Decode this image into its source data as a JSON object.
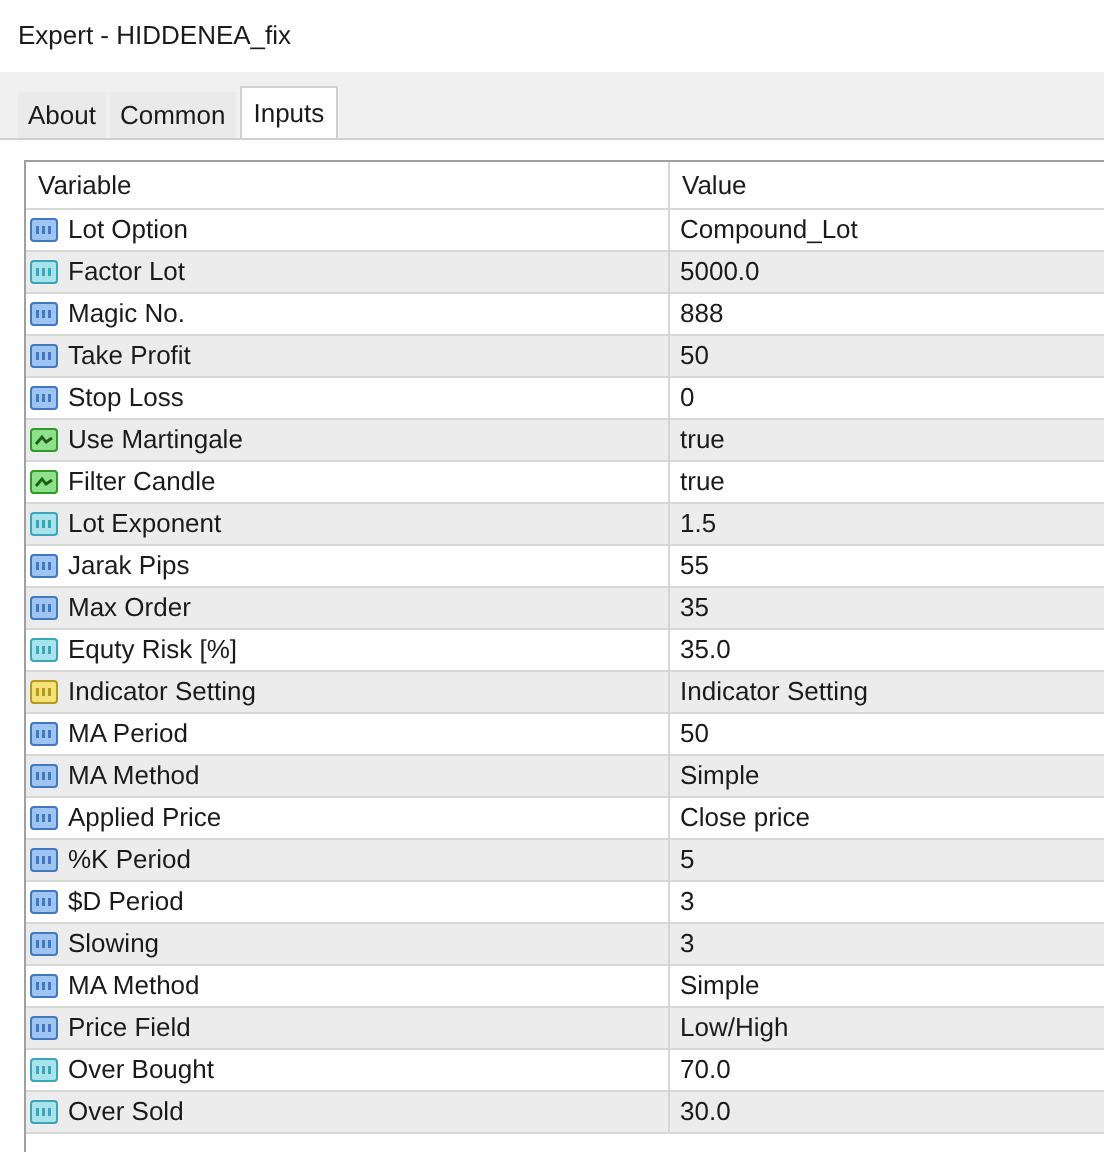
{
  "window": {
    "title": "Expert - HIDDENEA_fix"
  },
  "tabs": [
    {
      "label": "About",
      "selected": false
    },
    {
      "label": "Common",
      "selected": false
    },
    {
      "label": "Inputs",
      "selected": true
    }
  ],
  "table": {
    "columns": [
      "Variable",
      "Value"
    ],
    "rows": [
      {
        "kind": "int",
        "variable": "Lot Option",
        "value": "Compound_Lot"
      },
      {
        "kind": "double",
        "variable": "Factor Lot",
        "value": "5000.0"
      },
      {
        "kind": "int",
        "variable": "Magic No.",
        "value": "888"
      },
      {
        "kind": "int",
        "variable": "Take Profit",
        "value": "50"
      },
      {
        "kind": "int",
        "variable": "Stop Loss",
        "value": "0"
      },
      {
        "kind": "bool",
        "variable": "Use Martingale",
        "value": "true"
      },
      {
        "kind": "bool",
        "variable": "Filter Candle",
        "value": "true"
      },
      {
        "kind": "double",
        "variable": "Lot Exponent",
        "value": "1.5"
      },
      {
        "kind": "int",
        "variable": "Jarak Pips",
        "value": "55"
      },
      {
        "kind": "int",
        "variable": "Max Order",
        "value": "35"
      },
      {
        "kind": "double",
        "variable": "Equty Risk [%]",
        "value": "35.0"
      },
      {
        "kind": "string",
        "variable": "Indicator Setting",
        "value": "Indicator Setting"
      },
      {
        "kind": "int",
        "variable": "MA Period",
        "value": "50"
      },
      {
        "kind": "int",
        "variable": "MA Method",
        "value": "Simple"
      },
      {
        "kind": "int",
        "variable": "Applied Price",
        "value": "Close price"
      },
      {
        "kind": "int",
        "variable": "%K Period",
        "value": "5"
      },
      {
        "kind": "int",
        "variable": "$D Period",
        "value": "3"
      },
      {
        "kind": "int",
        "variable": "Slowing",
        "value": "3"
      },
      {
        "kind": "int",
        "variable": "MA Method",
        "value": "Simple"
      },
      {
        "kind": "int",
        "variable": "Price Field",
        "value": "Low/High"
      },
      {
        "kind": "double",
        "variable": "Over Bought",
        "value": "70.0"
      },
      {
        "kind": "double",
        "variable": "Over Sold",
        "value": "30.0"
      }
    ]
  }
}
